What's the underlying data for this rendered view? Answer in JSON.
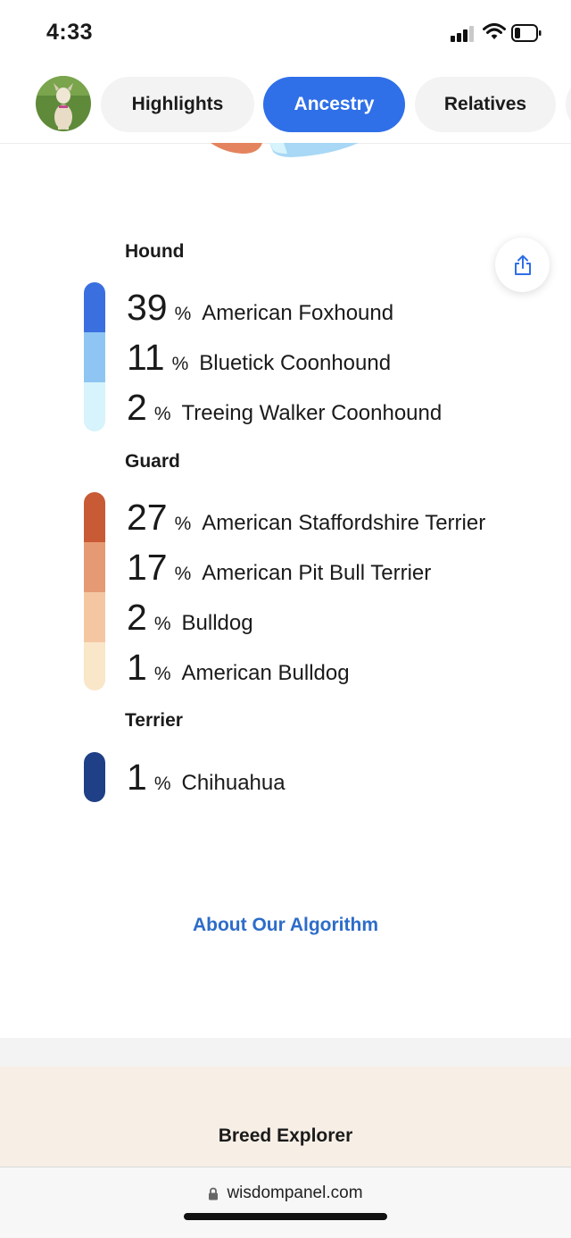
{
  "status_bar": {
    "time": "4:33"
  },
  "tabs": [
    {
      "label": "Highlights",
      "active": false
    },
    {
      "label": "Ancestry",
      "active": true
    },
    {
      "label": "Relatives",
      "active": false
    }
  ],
  "groups": [
    {
      "title": "Hound",
      "breeds": [
        {
          "pct": "39",
          "sign": "%",
          "name": "American Foxhound",
          "color": "#3a6fe0"
        },
        {
          "pct": "11",
          "sign": "%",
          "name": "Bluetick Coonhound",
          "color": "#8ec5f2"
        },
        {
          "pct": "2",
          "sign": "%",
          "name": "Treeing Walker Coonhound",
          "color": "#d7f3fb"
        }
      ]
    },
    {
      "title": "Guard",
      "breeds": [
        {
          "pct": "27",
          "sign": "%",
          "name": "American Staffordshire Terrier",
          "color": "#c85a35"
        },
        {
          "pct": "17",
          "sign": "%",
          "name": "American Pit Bull Terrier",
          "color": "#e59a74"
        },
        {
          "pct": "2",
          "sign": "%",
          "name": "Bulldog",
          "color": "#f4c7a2"
        },
        {
          "pct": "1",
          "sign": "%",
          "name": "American Bulldog",
          "color": "#fae6c9"
        }
      ]
    },
    {
      "title": "Terrier",
      "breeds": [
        {
          "pct": "1",
          "sign": "%",
          "name": "Chihuahua",
          "color": "#1f3f86"
        }
      ]
    }
  ],
  "about_link": "About Our Algorithm",
  "breed_explorer": "Breed Explorer",
  "browser": {
    "url": "wisdompanel.com"
  },
  "colors": {
    "accent": "#2f6fe8",
    "link": "#2d6cc9",
    "explorer_bg": "#f7efe6"
  }
}
